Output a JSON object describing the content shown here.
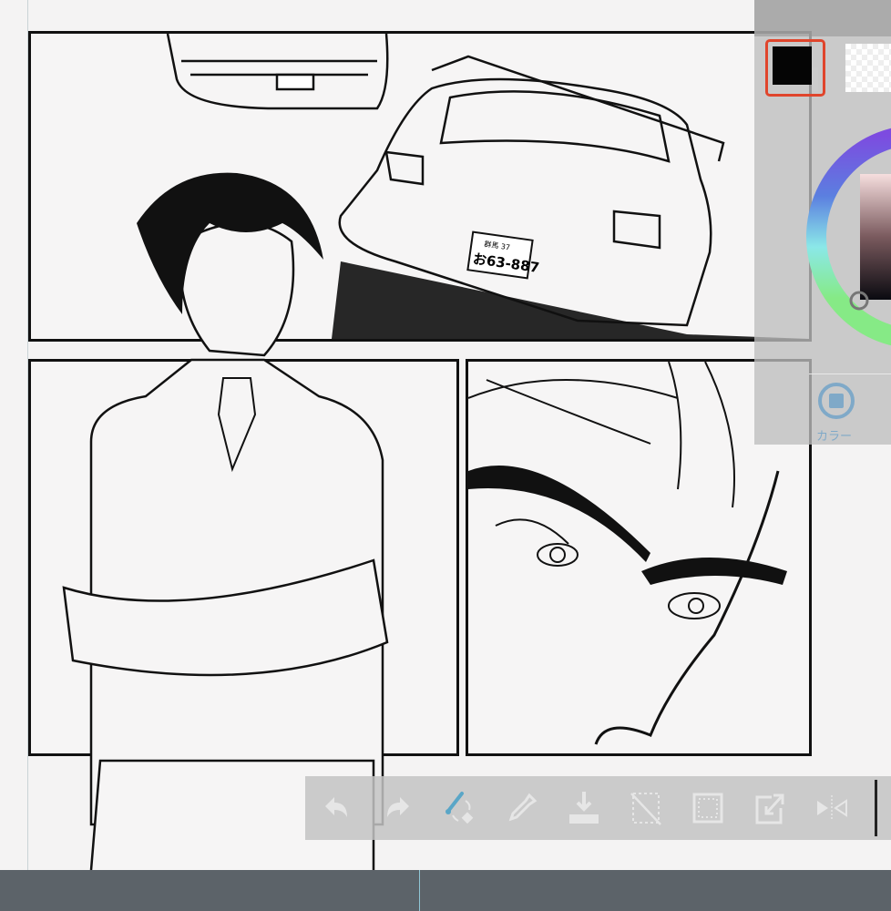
{
  "color_panel": {
    "main_color": "#050505",
    "sub_color": "#ffffff",
    "selection_border": "#e0452c",
    "tab_label": "カラー",
    "tab_icon": "color-square-icon"
  },
  "artwork": {
    "license_plate_top": "群馬 37",
    "license_plate_number": "お63-887"
  },
  "toolbar": {
    "items": [
      {
        "name": "undo",
        "icon": "undo-icon"
      },
      {
        "name": "redo",
        "icon": "redo-icon"
      },
      {
        "name": "brush-eraser-toggle",
        "icon": "brush-eraser-icon",
        "active": true
      },
      {
        "name": "eyedropper",
        "icon": "eyedropper-icon"
      },
      {
        "name": "fill",
        "icon": "fill-icon"
      },
      {
        "name": "clear-selection",
        "icon": "clear-selection-icon"
      },
      {
        "name": "select-all",
        "icon": "select-all-icon"
      },
      {
        "name": "transform",
        "icon": "transform-icon"
      },
      {
        "name": "flip-horizontal",
        "icon": "flip-horizontal-icon"
      }
    ],
    "active_color": "#5aa6c7"
  }
}
